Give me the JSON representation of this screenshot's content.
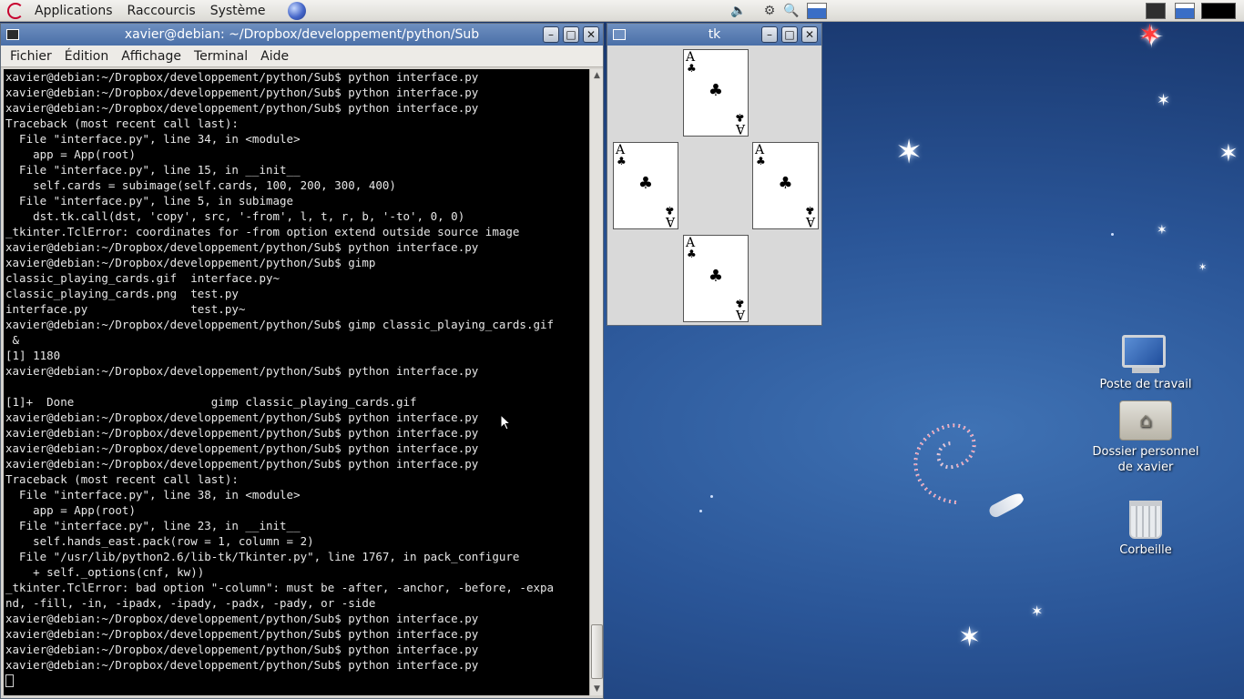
{
  "top_panel": {
    "menus": [
      "Applications",
      "Raccourcis",
      "Système"
    ],
    "tray_icons": [
      "volume-icon",
      "network-icon",
      "search-tool-icon",
      "window-icon"
    ]
  },
  "terminal": {
    "title": "xavier@debian: ~/Dropbox/developpement/python/Sub",
    "menu": [
      "Fichier",
      "Édition",
      "Affichage",
      "Terminal",
      "Aide"
    ],
    "lines": [
      "xavier@debian:~/Dropbox/developpement/python/Sub$ python interface.py",
      "xavier@debian:~/Dropbox/developpement/python/Sub$ python interface.py",
      "xavier@debian:~/Dropbox/developpement/python/Sub$ python interface.py",
      "Traceback (most recent call last):",
      "  File \"interface.py\", line 34, in <module>",
      "    app = App(root)",
      "  File \"interface.py\", line 15, in __init__",
      "    self.cards = subimage(self.cards, 100, 200, 300, 400)",
      "  File \"interface.py\", line 5, in subimage",
      "    dst.tk.call(dst, 'copy', src, '-from', l, t, r, b, '-to', 0, 0)",
      "_tkinter.TclError: coordinates for -from option extend outside source image",
      "xavier@debian:~/Dropbox/developpement/python/Sub$ python interface.py",
      "xavier@debian:~/Dropbox/developpement/python/Sub$ gimp",
      "classic_playing_cards.gif  interface.py~",
      "classic_playing_cards.png  test.py",
      "interface.py               test.py~",
      "xavier@debian:~/Dropbox/developpement/python/Sub$ gimp classic_playing_cards.gif",
      " &",
      "[1] 1180",
      "xavier@debian:~/Dropbox/developpement/python/Sub$ python interface.py",
      "",
      "[1]+  Done                    gimp classic_playing_cards.gif",
      "xavier@debian:~/Dropbox/developpement/python/Sub$ python interface.py",
      "xavier@debian:~/Dropbox/developpement/python/Sub$ python interface.py",
      "xavier@debian:~/Dropbox/developpement/python/Sub$ python interface.py",
      "xavier@debian:~/Dropbox/developpement/python/Sub$ python interface.py",
      "Traceback (most recent call last):",
      "  File \"interface.py\", line 38, in <module>",
      "    app = App(root)",
      "  File \"interface.py\", line 23, in __init__",
      "    self.hands_east.pack(row = 1, column = 2)",
      "  File \"/usr/lib/python2.6/lib-tk/Tkinter.py\", line 1767, in pack_configure",
      "    + self._options(cnf, kw))",
      "_tkinter.TclError: bad option \"-column\": must be -after, -anchor, -before, -expa",
      "nd, -fill, -in, -ipadx, -ipady, -padx, -pady, or -side",
      "xavier@debian:~/Dropbox/developpement/python/Sub$ python interface.py",
      "xavier@debian:~/Dropbox/developpement/python/Sub$ python interface.py",
      "xavier@debian:~/Dropbox/developpement/python/Sub$ python interface.py",
      "xavier@debian:~/Dropbox/developpement/python/Sub$ python interface.py"
    ]
  },
  "tk_window": {
    "title": "tk",
    "cards": [
      {
        "rank": "A",
        "suit": "♣"
      },
      {
        "rank": "A",
        "suit": "♣"
      },
      {
        "rank": "A",
        "suit": "♣"
      },
      {
        "rank": "A",
        "suit": "♣"
      }
    ]
  },
  "desktop_icons": [
    {
      "label": "Poste de travail",
      "icon": "computer-icon"
    },
    {
      "label": "Dossier personnel de xavier",
      "icon": "home-folder-icon"
    },
    {
      "label": "Corbeille",
      "icon": "trash-icon"
    }
  ],
  "colors": {
    "titlebar": "#4a6fa8",
    "desktop": "#2a5597",
    "terminal_bg": "#000000",
    "terminal_fg": "#e6e6e6"
  }
}
